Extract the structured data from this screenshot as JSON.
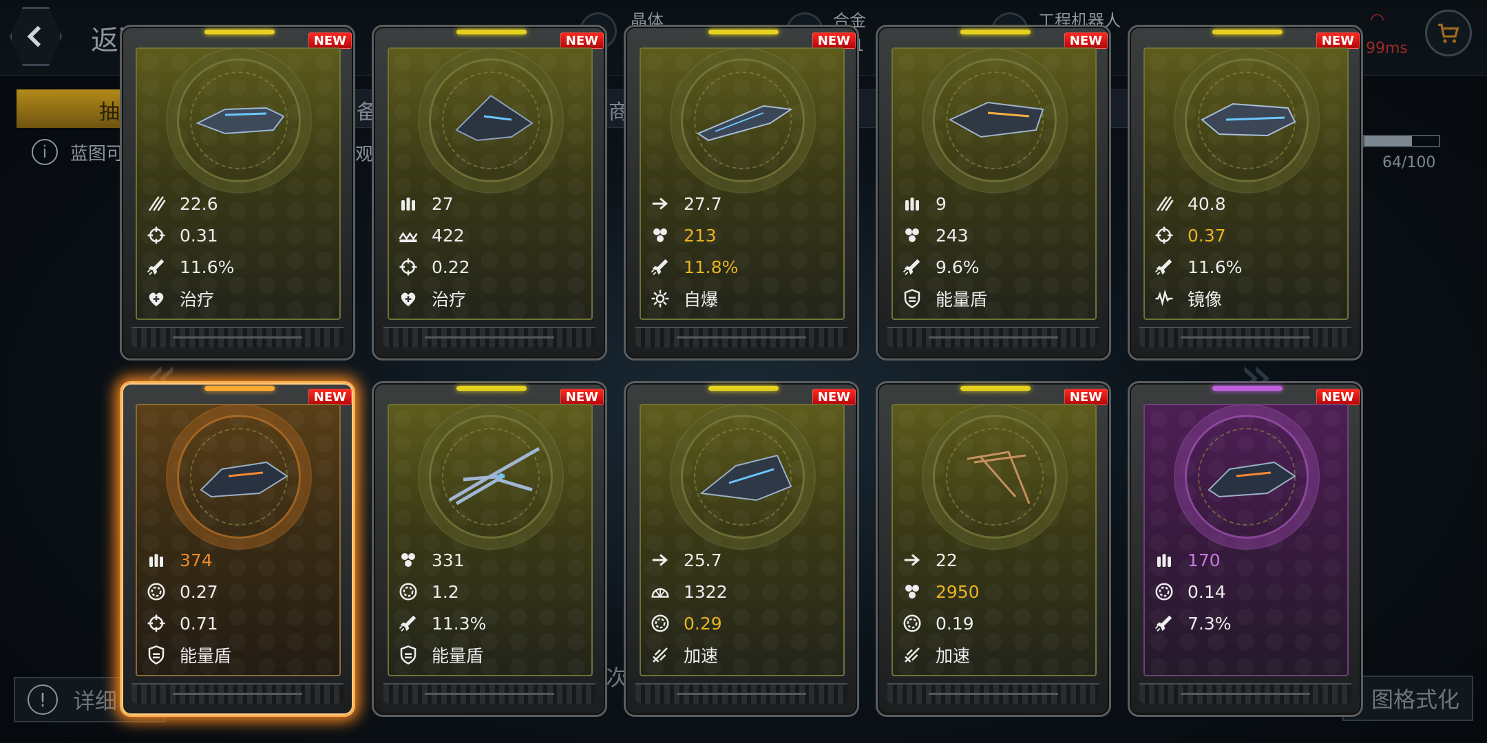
{
  "header": {
    "back_title": "返回",
    "resources": [
      {
        "label": "晶体",
        "value": ""
      },
      {
        "label": "合金",
        "value": "1"
      },
      {
        "label": "工程机器人",
        "value": ""
      }
    ],
    "ping": "99ms"
  },
  "background": {
    "tabs": [
      "抽",
      "备",
      "商"
    ],
    "info_text": "蓝图可",
    "info_text_tail": "观",
    "progress": {
      "text": "64/100",
      "fraction": 0.64
    },
    "bottom_left": "详细",
    "bottom_mid": "次",
    "bottom_right": "图格式化"
  },
  "new_label": "NEW",
  "cards": [
    {
      "rarity": "normal",
      "stats": [
        {
          "icon": "damage-icon",
          "value": "22.6",
          "color": ""
        },
        {
          "icon": "crosshair-icon",
          "value": "0.31",
          "color": ""
        },
        {
          "icon": "missile-icon",
          "value": "11.6%",
          "color": ""
        },
        {
          "icon": "heal-icon",
          "value": "治疗",
          "color": ""
        }
      ]
    },
    {
      "rarity": "normal",
      "stats": [
        {
          "icon": "ammo-icon",
          "value": "27",
          "color": ""
        },
        {
          "icon": "armor-icon",
          "value": "422",
          "color": ""
        },
        {
          "icon": "crosshair-icon",
          "value": "0.22",
          "color": ""
        },
        {
          "icon": "heal-icon",
          "value": "治疗",
          "color": ""
        }
      ]
    },
    {
      "rarity": "normal",
      "stats": [
        {
          "icon": "speed-icon",
          "value": "27.7",
          "color": ""
        },
        {
          "icon": "hull-icon",
          "value": "213",
          "color": "gold"
        },
        {
          "icon": "missile-icon",
          "value": "11.8%",
          "color": "gold"
        },
        {
          "icon": "explode-icon",
          "value": "自爆",
          "color": ""
        }
      ]
    },
    {
      "rarity": "normal",
      "stats": [
        {
          "icon": "ammo-icon",
          "value": "9",
          "color": ""
        },
        {
          "icon": "hull-icon",
          "value": "243",
          "color": ""
        },
        {
          "icon": "missile-icon",
          "value": "9.6%",
          "color": ""
        },
        {
          "icon": "shield-icon",
          "value": "能量盾",
          "color": ""
        }
      ]
    },
    {
      "rarity": "normal",
      "stats": [
        {
          "icon": "damage-icon",
          "value": "40.8",
          "color": ""
        },
        {
          "icon": "crosshair-icon",
          "value": "0.37",
          "color": "gold"
        },
        {
          "icon": "missile-icon",
          "value": "11.6%",
          "color": ""
        },
        {
          "icon": "mirror-icon",
          "value": "镜像",
          "color": ""
        }
      ]
    },
    {
      "rarity": "selected",
      "stats": [
        {
          "icon": "ammo-icon",
          "value": "374",
          "color": "orange"
        },
        {
          "icon": "reload-icon",
          "value": "0.27",
          "color": ""
        },
        {
          "icon": "crosshair-icon",
          "value": "0.71",
          "color": ""
        },
        {
          "icon": "shield-icon",
          "value": "能量盾",
          "color": ""
        }
      ]
    },
    {
      "rarity": "normal",
      "stats": [
        {
          "icon": "hull-icon",
          "value": "331",
          "color": ""
        },
        {
          "icon": "reload-icon",
          "value": "1.2",
          "color": ""
        },
        {
          "icon": "missile-icon",
          "value": "11.3%",
          "color": ""
        },
        {
          "icon": "shield-icon",
          "value": "能量盾",
          "color": ""
        }
      ]
    },
    {
      "rarity": "normal",
      "stats": [
        {
          "icon": "speed-icon",
          "value": "25.7",
          "color": ""
        },
        {
          "icon": "radar-icon",
          "value": "1322",
          "color": ""
        },
        {
          "icon": "reload-icon",
          "value": "0.29",
          "color": "gold"
        },
        {
          "icon": "boost-icon",
          "value": "加速",
          "color": ""
        }
      ]
    },
    {
      "rarity": "normal",
      "stats": [
        {
          "icon": "speed-icon",
          "value": "22",
          "color": ""
        },
        {
          "icon": "hull-icon",
          "value": "2950",
          "color": "gold"
        },
        {
          "icon": "reload-icon",
          "value": "0.19",
          "color": ""
        },
        {
          "icon": "boost-icon",
          "value": "加速",
          "color": ""
        }
      ]
    },
    {
      "rarity": "epic",
      "stats": [
        {
          "icon": "ammo-icon",
          "value": "170",
          "color": "purple"
        },
        {
          "icon": "reload-icon",
          "value": "0.14",
          "color": ""
        },
        {
          "icon": "missile-icon",
          "value": "7.3%",
          "color": ""
        }
      ]
    }
  ],
  "colors": {
    "gold": "#e8b420",
    "orange": "#f08a28",
    "purple": "#c77ae0",
    "new_badge": "#e01818"
  }
}
